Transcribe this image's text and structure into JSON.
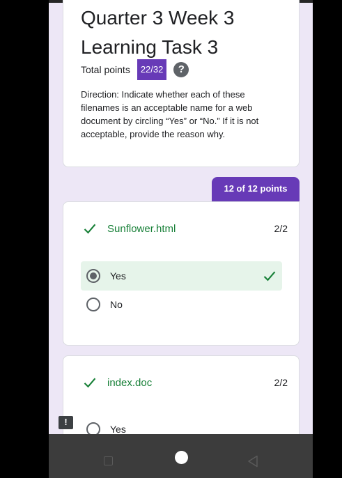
{
  "form": {
    "title": "Quarter 3 Week 3 Learning Task 3",
    "total_points_label": "Total points",
    "total_points_value": "22/32",
    "help_glyph": "?",
    "description": "Direction: Indicate whether each of these filenames is an acceptable name for a web document by circling “Yes” or “No.” If it is not acceptable, provide the reason why."
  },
  "section": {
    "score_tab": "12 of 12 points"
  },
  "questions": [
    {
      "title": "Sunflower.html",
      "score": "2/2",
      "options": [
        {
          "label": "Yes",
          "selected": true,
          "correct": true
        },
        {
          "label": "No",
          "selected": false
        }
      ]
    },
    {
      "title": "index.doc",
      "score": "2/2",
      "options": [
        {
          "label": "Yes",
          "selected": false
        }
      ]
    }
  ],
  "report_glyph": "!",
  "colors": {
    "accent": "#673ab7",
    "background": "#ede7f6",
    "correct_green": "#188038",
    "correct_bg": "#e6f4ea"
  },
  "icons": {
    "help": "help-circle-icon",
    "correct": "check-icon",
    "report": "report-problem-icon",
    "nav_recents": "square-icon",
    "nav_home": "circle-icon",
    "nav_back": "triangle-back-icon"
  }
}
